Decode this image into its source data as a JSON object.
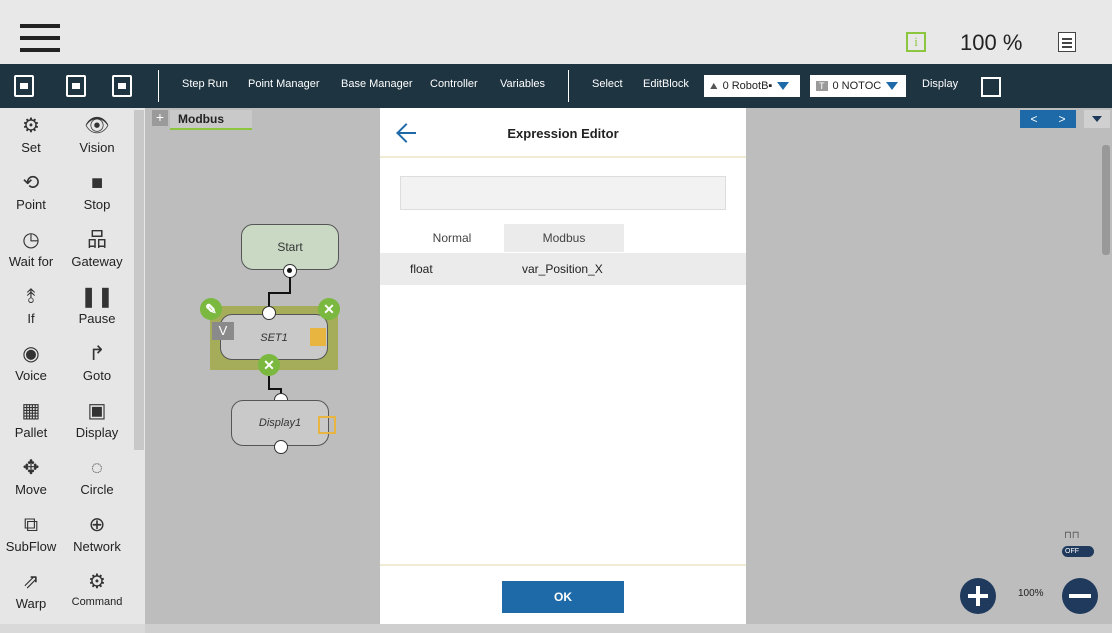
{
  "header": {
    "menu_icon": "hamburger-icon",
    "info_icon_glyph": "i",
    "zoom_percent": "100 %",
    "log_icon": "document-icon"
  },
  "toolbar": {
    "items": [
      "Step Run",
      "Point Manager",
      "Base Manager",
      "Controller",
      "Variables",
      "Select",
      "EditBlock",
      "Display"
    ],
    "robot_select": {
      "badge": "⛰",
      "value": "0 RobotB▪"
    },
    "tcp_select": {
      "badge": "T",
      "value": "0 NOTOC"
    }
  },
  "palette": {
    "items": [
      {
        "label": "Set",
        "icon": "⚙"
      },
      {
        "label": "Vision",
        "icon": "👁"
      },
      {
        "label": "Point",
        "icon": "⟲"
      },
      {
        "label": "Stop",
        "icon": "■"
      },
      {
        "label": "Wait for",
        "icon": "◷"
      },
      {
        "label": "Gateway",
        "icon": "品"
      },
      {
        "label": "If",
        "icon": "⥉"
      },
      {
        "label": "Pause",
        "icon": "❚❚"
      },
      {
        "label": "Voice",
        "icon": "◉"
      },
      {
        "label": "Goto",
        "icon": "↱"
      },
      {
        "label": "Pallet",
        "icon": "▦"
      },
      {
        "label": "Display",
        "icon": "▣"
      },
      {
        "label": "Move",
        "icon": "✥"
      },
      {
        "label": "Circle",
        "icon": "◌"
      },
      {
        "label": "SubFlow",
        "icon": "⧉"
      },
      {
        "label": "Network",
        "icon": "⊕"
      },
      {
        "label": "Warp",
        "icon": "⇗"
      },
      {
        "label": "Command",
        "icon": "⚙"
      }
    ]
  },
  "canvas": {
    "add_tab": "+",
    "active_tab": "Modbus",
    "nav_prev": "<",
    "nav_next": ">",
    "zoom_level": "100%",
    "toggle_label": "OFF",
    "nodes": {
      "start": "Start",
      "set": "SET1",
      "set_badge": "V",
      "display": "Display1"
    }
  },
  "modal": {
    "title": "Expression Editor",
    "expression_value": "",
    "tabs": [
      "Normal",
      "Modbus"
    ],
    "active_tab": "Modbus",
    "variables": [
      {
        "type": "float",
        "name": "var_Position_X"
      }
    ],
    "ok_label": "OK"
  },
  "colors": {
    "toolbar_bg": "#1f3441",
    "accent_blue": "#1e6aa8",
    "accent_green": "#8cc63f",
    "node_highlight": "#a6ad5a"
  }
}
